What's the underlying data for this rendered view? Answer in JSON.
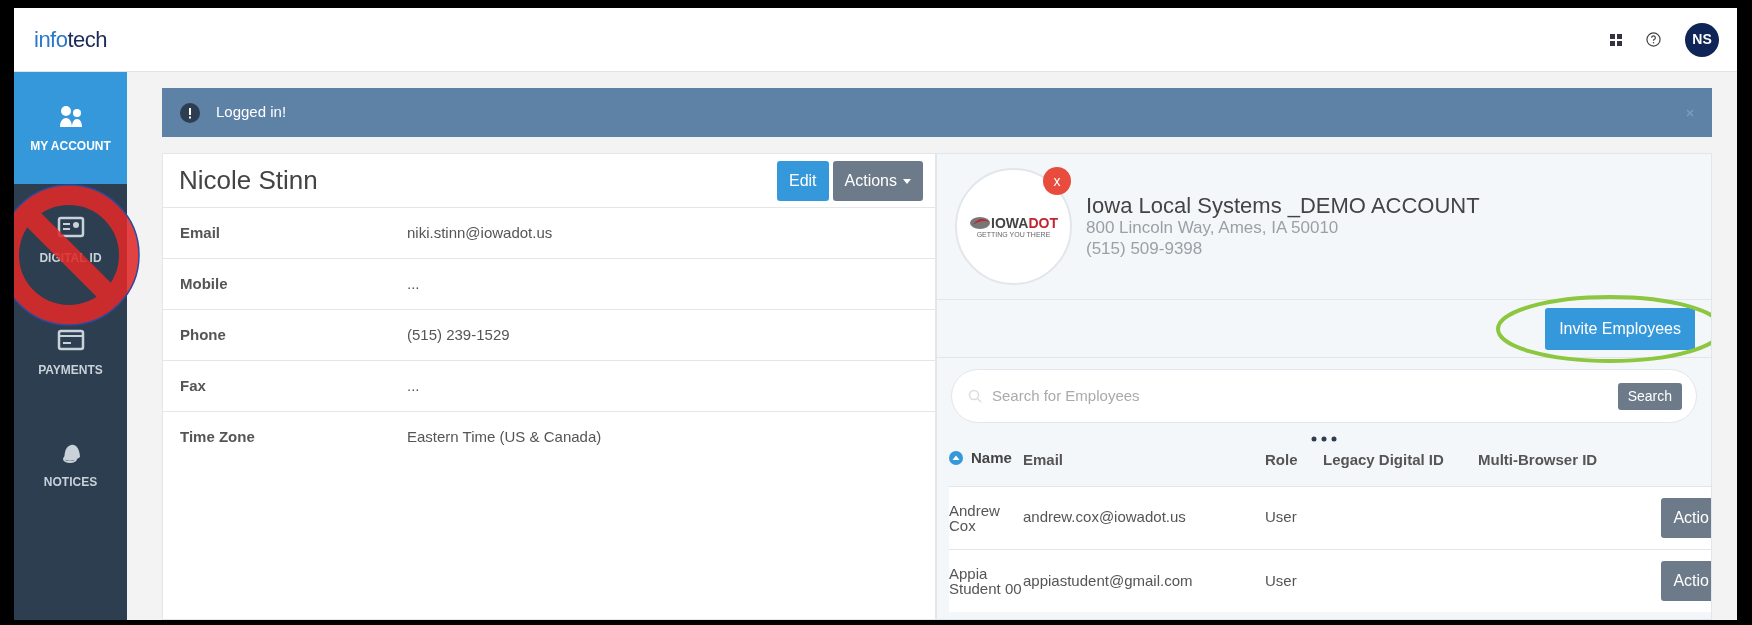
{
  "logo": {
    "lead": "info",
    "rest": "tech"
  },
  "header": {
    "avatar": "NS"
  },
  "sidebar": {
    "items": [
      {
        "kind": "users",
        "label": "MY ACCOUNT",
        "selected": true
      },
      {
        "kind": "id",
        "label": "DIGITAL ID",
        "selected": false
      },
      {
        "kind": "card",
        "label": "PAYMENTS",
        "selected": false
      },
      {
        "kind": "bell",
        "label": "NOTICES",
        "selected": false
      }
    ]
  },
  "alert": {
    "message": "Logged in!"
  },
  "profile": {
    "name": "Nicole Stinn",
    "buttons": [
      {
        "kind": "primary",
        "label": "Edit"
      },
      {
        "kind": "dropdown",
        "label": "Actions"
      }
    ],
    "fields": [
      {
        "label": "Email",
        "value": "niki.stinn@iowadot.us"
      },
      {
        "label": "Mobile",
        "value": "..."
      },
      {
        "label": "Phone",
        "value": "(515) 239-1529"
      },
      {
        "label": "Fax",
        "value": "..."
      },
      {
        "label": "Time Zone",
        "value": "Eastern Time (US & Canada)"
      }
    ]
  },
  "organization": {
    "logo": {
      "lead": "IOWA",
      "rest": "DOT",
      "tagline": "GETTING YOU THERE"
    },
    "remove": "x",
    "name": "Iowa Local Systems _DEMO ACCOUNT",
    "address": "800 Lincoln Way, Ames, IA 50010",
    "phone": "(515) 509-9398"
  },
  "invite_button": "Invite Employees",
  "search": {
    "placeholder": "Search for Employees",
    "button": "Search"
  },
  "table": {
    "columns": [
      {
        "label": "Name",
        "sorted": true
      },
      {
        "label": "Email",
        "sorted": false
      },
      {
        "label": "Role",
        "sorted": false
      },
      {
        "label": "Legacy Digital ID",
        "sorted": false
      },
      {
        "label": "Multi-Browser ID",
        "sorted": false
      }
    ],
    "rows": [
      {
        "name": "Andrew Cox",
        "email": "andrew.cox@iowadot.us",
        "role": "User",
        "action": "Actio"
      },
      {
        "name": "Appia Student 00",
        "email": "appiastudent@gmail.com",
        "role": "User",
        "action": "Actio"
      }
    ]
  }
}
